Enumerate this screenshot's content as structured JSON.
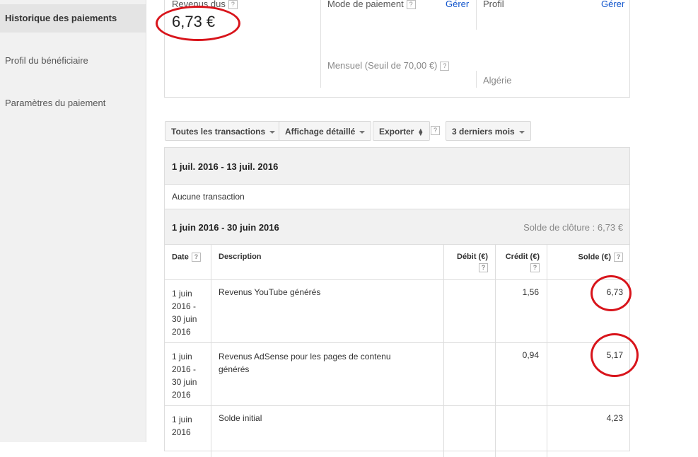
{
  "sidebar": {
    "items": [
      {
        "label": "Historique des paiements"
      },
      {
        "label": "Profil du bénéficiaire"
      },
      {
        "label": "Paramètres du paiement"
      }
    ]
  },
  "summary": {
    "revenue_label": "Revenus dus",
    "revenue_value": "6,73 €",
    "payment_mode_label": "Mode de paiement",
    "manage_link": "Gérer",
    "schedule": "Mensuel (Seuil de 70,00 €)",
    "profile_label": "Profil",
    "profile_manage_link": "Gérer",
    "country": "Algérie"
  },
  "help_glyph": "?",
  "toolbar": {
    "transactions_filter": "Toutes les transactions",
    "view_mode": "Affichage détaillé",
    "export": "Exporter",
    "date_range": "3 derniers mois"
  },
  "periods": [
    {
      "range": "1 juil. 2016 - 13 juil. 2016",
      "empty_text": "Aucune transaction"
    },
    {
      "range": "1 juin 2016 - 30 juin 2016",
      "closing_balance": "Solde de clôture : 6,73 €"
    }
  ],
  "table_headers": {
    "date": "Date",
    "description": "Description",
    "debit": "Débit (€)",
    "credit": "Crédit (€)",
    "balance": "Solde (€)"
  },
  "rows": [
    {
      "date": [
        "1 juin",
        "2016 -",
        "30 juin",
        "2016"
      ],
      "description": [
        "Revenus YouTube générés"
      ],
      "debit": "",
      "credit": "1,56",
      "balance": "6,73"
    },
    {
      "date": [
        "1 juin",
        "2016 -",
        "30 juin",
        "2016"
      ],
      "description": [
        "Revenus AdSense pour les pages de contenu",
        "générés"
      ],
      "debit": "",
      "credit": "0,94",
      "balance": "5,17"
    },
    {
      "date": [
        "1 juin",
        "2016"
      ],
      "description": [
        "Solde initial"
      ],
      "debit": "",
      "credit": "",
      "balance": "4,23"
    }
  ],
  "annotation_color": "#d8141b"
}
